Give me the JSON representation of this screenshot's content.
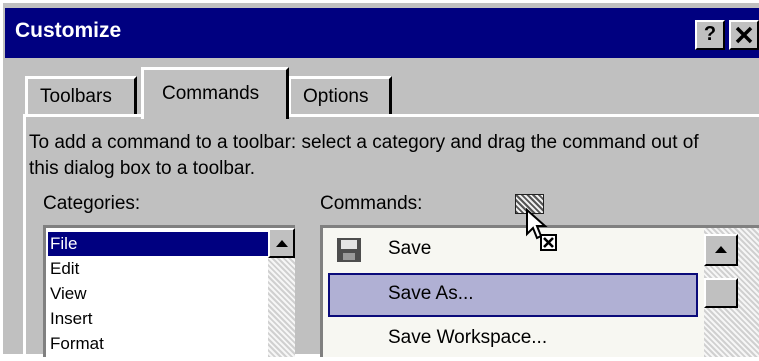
{
  "dialog": {
    "title": "Customize",
    "help_label": "?",
    "close_label": "✕"
  },
  "tabs": [
    {
      "label": "Toolbars",
      "active": false
    },
    {
      "label": "Commands",
      "active": true
    },
    {
      "label": "Options",
      "active": false
    }
  ],
  "instructions": "To add a command to a toolbar: select a category and drag the command out of this dialog box to a toolbar.",
  "categories": {
    "label": "Categories:",
    "items": [
      "File",
      "Edit",
      "View",
      "Insert",
      "Format"
    ],
    "selected": "File"
  },
  "commands": {
    "label": "Commands:",
    "items": [
      {
        "label": "Save",
        "icon": "floppy-disk-icon"
      },
      {
        "label": "Save As...",
        "highlighted": true
      },
      {
        "label": "Save Workspace..."
      }
    ]
  },
  "drag_cursor": {
    "icon": "drag-copy-cursor-icon",
    "badge": "✕"
  },
  "colors": {
    "title_bar": "#000080",
    "dialog_face": "#c0c0c0",
    "selection": "#000080",
    "command_highlight": "#b0b0d4"
  }
}
